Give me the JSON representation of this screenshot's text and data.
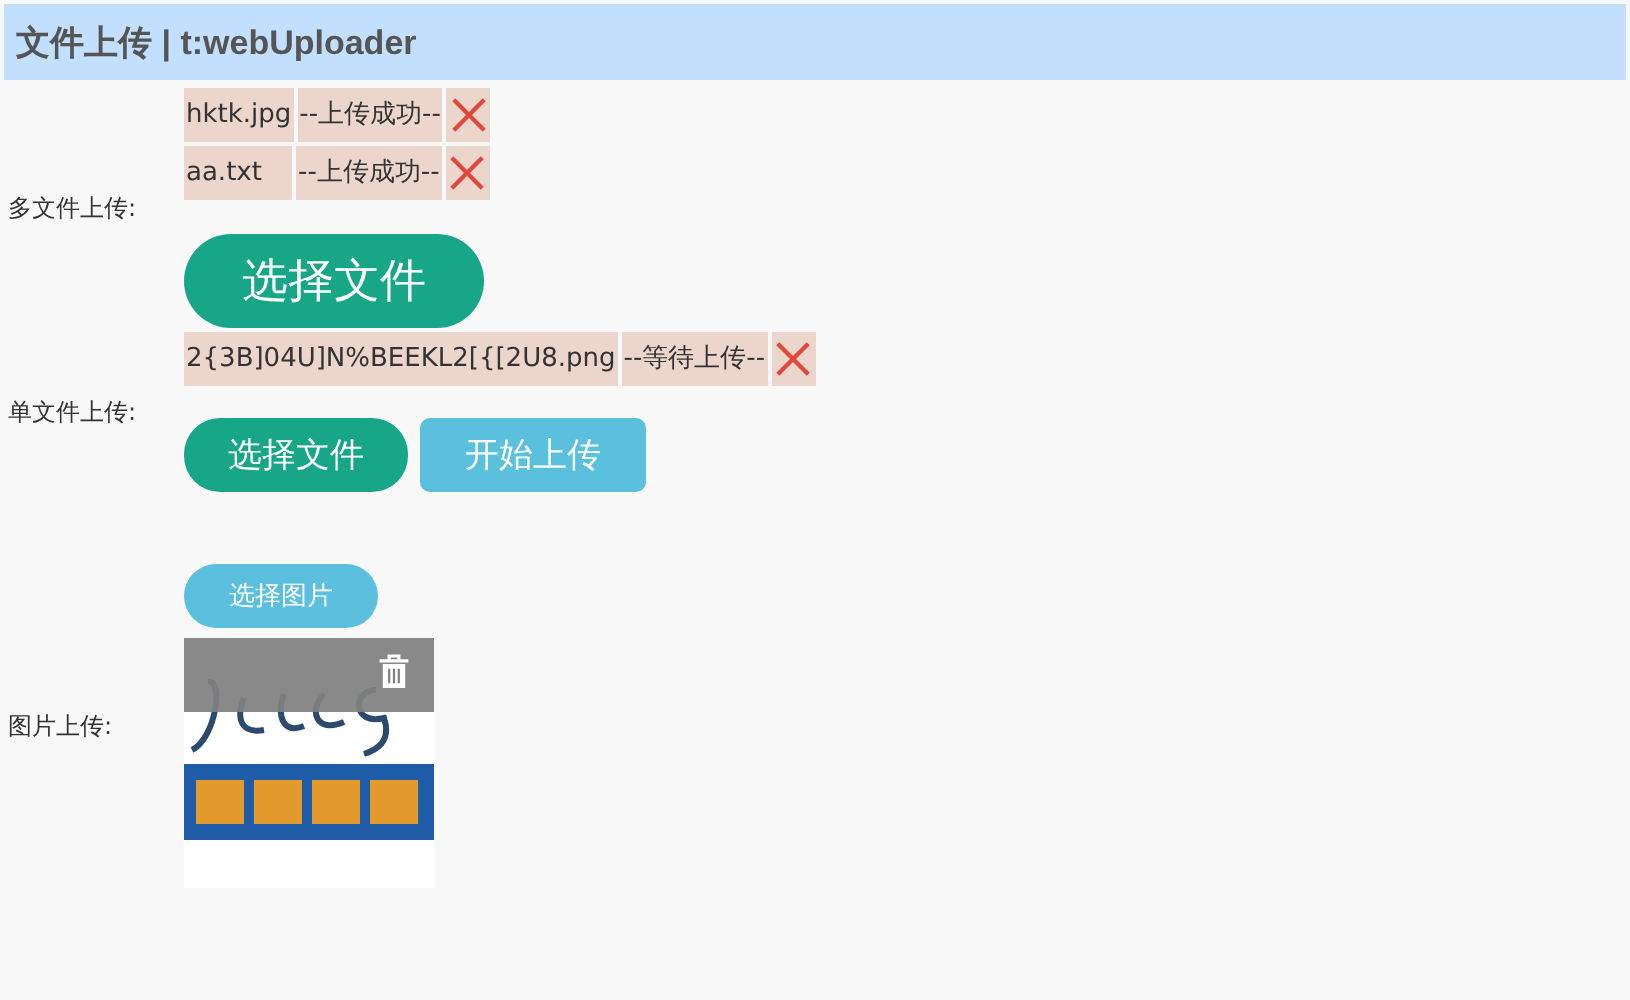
{
  "header": {
    "title": "文件上传 | t:webUploader"
  },
  "sections": [
    {
      "kind": "multi",
      "label": "多文件上传:",
      "files": [
        {
          "name": "hktk.jpg",
          "status": "--上传成功--"
        },
        {
          "name": "aa.txt",
          "status": "--上传成功--"
        }
      ],
      "buttons": [
        {
          "label": "选择文件",
          "kind": "large"
        }
      ]
    },
    {
      "kind": "single",
      "label": "单文件上传:",
      "files": [
        {
          "name": "2{3B]04U]N%BEEKL2[{[2U8.png",
          "status": "--等待上传--"
        }
      ],
      "buttons": [
        {
          "label": "选择文件",
          "kind": "pick"
        },
        {
          "label": "开始上传",
          "kind": "upload"
        }
      ]
    },
    {
      "label": "图片上传:",
      "buttons": [
        {
          "label": "选择图片",
          "kind": "small"
        }
      ],
      "images": [
        {
          "kind": "picture"
        }
      ]
    }
  ]
}
